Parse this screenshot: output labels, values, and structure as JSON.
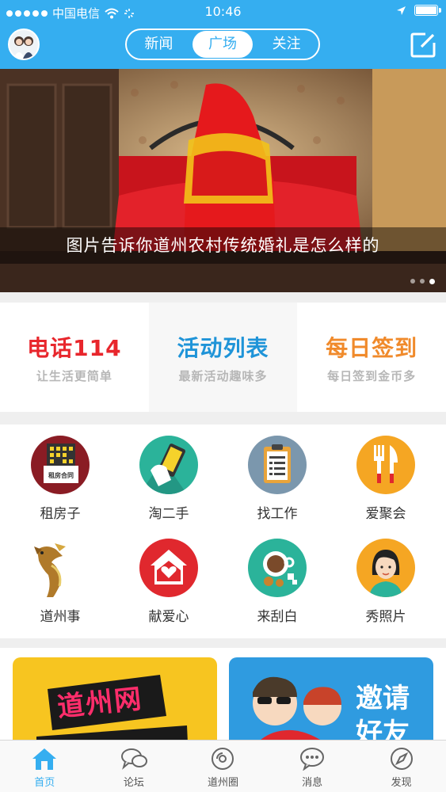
{
  "status_bar": {
    "carrier": "中国电信",
    "time": "10:46"
  },
  "header": {
    "tabs": [
      {
        "label": "新闻",
        "active": false
      },
      {
        "label": "广场",
        "active": true
      },
      {
        "label": "关注",
        "active": false
      }
    ],
    "accent_color": "#35aef0"
  },
  "banner": {
    "caption": "图片告诉你道州农村传统婚礼是怎么样的",
    "page_count": 3,
    "current_page": 3
  },
  "quick_entries": [
    {
      "title": "电话114",
      "subtitle": "让生活更简单",
      "color": "#e8262c"
    },
    {
      "title": "活动列表",
      "subtitle": "最新活动趣味多",
      "color": "#1f94d8"
    },
    {
      "title": "每日签到",
      "subtitle": "每日签到金币多",
      "color": "#f08a2b"
    }
  ],
  "grid_items": [
    {
      "label": "租房子",
      "icon": "rental-contract-icon",
      "color": "#8a1c24",
      "badge_text": "租房合同"
    },
    {
      "label": "淘二手",
      "icon": "phone-hand-icon",
      "color": "#2bb39a"
    },
    {
      "label": "找工作",
      "icon": "clipboard-icon",
      "color": "#7b97ad"
    },
    {
      "label": "爱聚会",
      "icon": "fork-knife-icon",
      "color": "#f5a623"
    },
    {
      "label": "道州事",
      "icon": "dragon-icon",
      "color": "#ffffff"
    },
    {
      "label": "献爱心",
      "icon": "heart-house-icon",
      "color": "#e0282e"
    },
    {
      "label": "来刮白",
      "icon": "coffee-cup-icon",
      "color": "#2bb39a"
    },
    {
      "label": "秀照片",
      "icon": "girl-avatar-icon",
      "color": "#f5a623"
    }
  ],
  "promos": [
    {
      "text": "道州网",
      "color": "#f7c520"
    },
    {
      "text": "邀请好友",
      "color": "#2f9be0"
    }
  ],
  "tabbar": [
    {
      "label": "首页",
      "icon": "home-icon",
      "active": true
    },
    {
      "label": "论坛",
      "icon": "chat-bubbles-icon",
      "active": false
    },
    {
      "label": "道州圈",
      "icon": "circle-disc-icon",
      "active": false
    },
    {
      "label": "消息",
      "icon": "message-dots-icon",
      "active": false
    },
    {
      "label": "发现",
      "icon": "compass-icon",
      "active": false
    }
  ]
}
